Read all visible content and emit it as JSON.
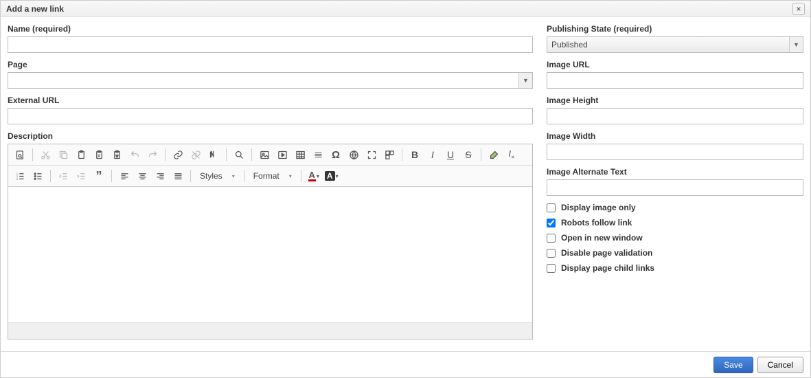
{
  "dialog": {
    "title": "Add a new link",
    "close_label": "×"
  },
  "left": {
    "name_label": "Name (required)",
    "name_value": "",
    "page_label": "Page",
    "page_value": "",
    "external_label": "External URL",
    "external_value": "",
    "description_label": "Description"
  },
  "toolbar": {
    "styles_label": "Styles",
    "format_label": "Format"
  },
  "right": {
    "state_label": "Publishing State (required)",
    "state_value": "Published",
    "imgurl_label": "Image URL",
    "imgurl_value": "",
    "imgh_label": "Image Height",
    "imgh_value": "",
    "imgw_label": "Image Width",
    "imgw_value": "",
    "imgalt_label": "Image Alternate Text",
    "imgalt_value": "",
    "checks": {
      "display_image_only": {
        "label": "Display image only",
        "checked": false
      },
      "robots_follow": {
        "label": "Robots follow link",
        "checked": true
      },
      "open_new_window": {
        "label": "Open in new window",
        "checked": false
      },
      "disable_validation": {
        "label": "Disable page validation",
        "checked": false
      },
      "display_child": {
        "label": "Display page child links",
        "checked": false
      }
    }
  },
  "footer": {
    "save_label": "Save",
    "cancel_label": "Cancel"
  }
}
